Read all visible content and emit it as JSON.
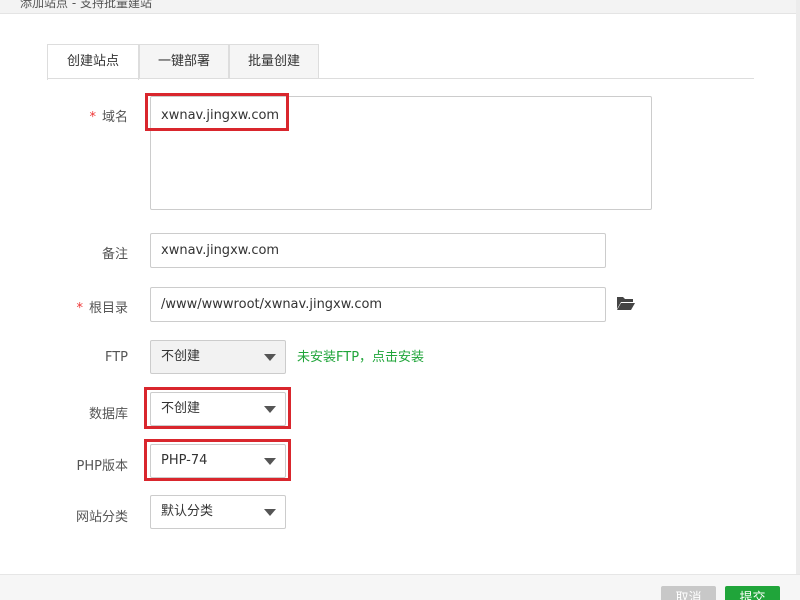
{
  "window": {
    "title": "添加站点 - 支持批量建站"
  },
  "tabs": [
    {
      "label": "创建站点",
      "active": true
    },
    {
      "label": "一键部署",
      "active": false
    },
    {
      "label": "批量创建",
      "active": false
    }
  ],
  "form": {
    "domain": {
      "label": "域名",
      "required": true,
      "value": "xwnav.jingxw.com"
    },
    "remark": {
      "label": "备注",
      "value": "xwnav.jingxw.com"
    },
    "root": {
      "label": "根目录",
      "required": true,
      "value": "/www/wwwroot/xwnav.jingxw.com",
      "icon": "folder-open-icon"
    },
    "ftp": {
      "label": "FTP",
      "selected": "不创建",
      "hint": "未安装FTP，点击安装"
    },
    "database": {
      "label": "数据库",
      "selected": "不创建"
    },
    "php": {
      "label": "PHP版本",
      "selected": "PHP-74"
    },
    "category": {
      "label": "网站分类",
      "selected": "默认分类"
    }
  },
  "buttons": {
    "cancel": "取消",
    "submit": "提交"
  },
  "colors": {
    "highlight": "#d9262d",
    "accent": "#20a53a",
    "required": "#ee3333"
  }
}
